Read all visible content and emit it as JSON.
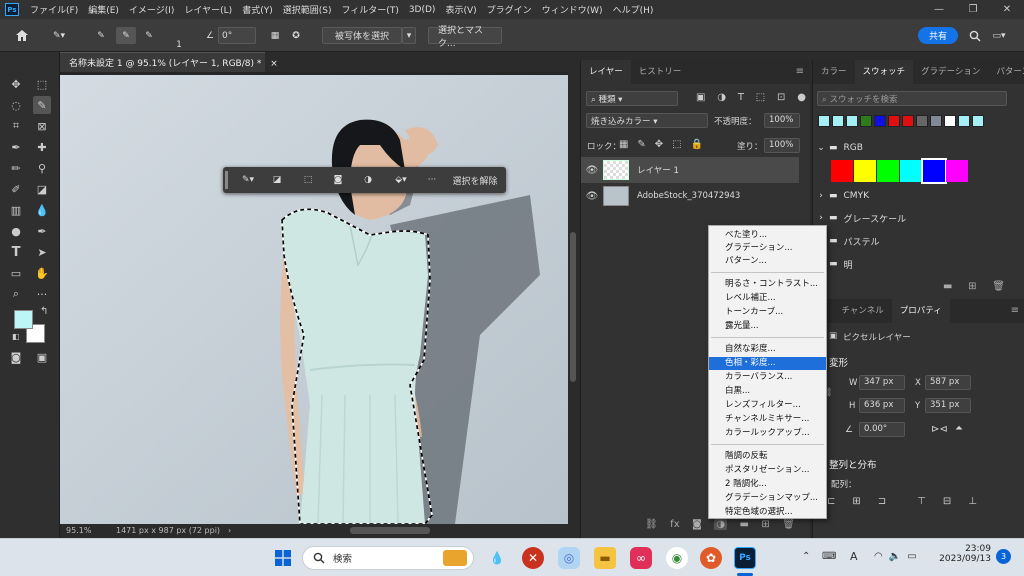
{
  "menubar": {
    "app_icon": "Ps",
    "items": [
      "ファイル(F)",
      "編集(E)",
      "イメージ(I)",
      "レイヤー(L)",
      "書式(Y)",
      "選択範囲(S)",
      "フィルター(T)",
      "3D(D)",
      "表示(V)",
      "プラグイン",
      "ウィンドウ(W)",
      "ヘルプ(H)"
    ],
    "min": "—",
    "max": "❐",
    "close": "✕"
  },
  "options": {
    "brush_size": "1",
    "angle": "0°",
    "select_subject": "被写体を選択",
    "select_mask": "選択とマスク...",
    "share": "共有"
  },
  "document": {
    "tab_title": "名称未設定 1 @ 95.1% (レイヤー 1, RGB/8) *",
    "close": "×",
    "zoom": "95.1%",
    "dims": "1471 px x 987 px (72 ppi)"
  },
  "contextbar": {
    "deselect": "選択を解除",
    "more": "···"
  },
  "layers_panel": {
    "tabs": [
      "レイヤー",
      "ヒストリー"
    ],
    "filter": "種類",
    "blend": "焼き込みカラー",
    "opacity_label": "不透明度：",
    "opacity": "100%",
    "lock_label": "ロック：",
    "fill_label": "塗り：",
    "fill": "100%",
    "layers": [
      "レイヤー 1",
      "AdobeStock_370472943"
    ]
  },
  "adjustments": {
    "groups": [
      [
        "べた塗り...",
        "グラデーション...",
        "パターン..."
      ],
      [
        "明るさ・コントラスト...",
        "レベル補正...",
        "トーンカーブ...",
        "露光量..."
      ],
      [
        "自然な彩度...",
        "色相・彩度...",
        "カラーバランス...",
        "白黒...",
        "レンズフィルター...",
        "チャンネルミキサー...",
        "カラールックアップ..."
      ],
      [
        "階調の反転",
        "ポスタリゼーション...",
        "2 階調化...",
        "グラデーションマップ...",
        "特定色域の選択..."
      ]
    ],
    "highlighted": "色相・彩度..."
  },
  "swatches": {
    "tabs": [
      "カラー",
      "スウォッチ",
      "グラデーション",
      "パターン"
    ],
    "search_placeholder": "スウォッチを検索",
    "recent": [
      "#a5f0f6",
      "#a5f0f6",
      "#a5f0f6",
      "#2f7a1a",
      "#1010e0",
      "#e01010",
      "#e01010",
      "#666666",
      "#7f8a95",
      "#ffffff",
      "#a5f0f6",
      "#a5f0f6"
    ],
    "groups": [
      "RGB",
      "CMYK",
      "グレースケール",
      "パステル",
      "明"
    ],
    "rgb_colors": [
      "#ff0000",
      "#ffff00",
      "#00ff00",
      "#00ffff",
      "#0000ff",
      "#ff00ff"
    ]
  },
  "properties": {
    "tabs": [
      "ス",
      "チャンネル",
      "プロパティ"
    ],
    "kind": "ピクセルレイヤー",
    "transform": "変形",
    "w_label": "W",
    "w": "347 px",
    "x_label": "X",
    "x": "587 px",
    "h_label": "H",
    "h": "636 px",
    "y_label": "Y",
    "y": "351 px",
    "angle": "0.00°",
    "align_title": "整列と分布",
    "align_label": "配列："
  },
  "taskbar": {
    "search": "検索",
    "time": "23:09",
    "date": "2023/09/13",
    "notif": "3",
    "ime": "A"
  }
}
